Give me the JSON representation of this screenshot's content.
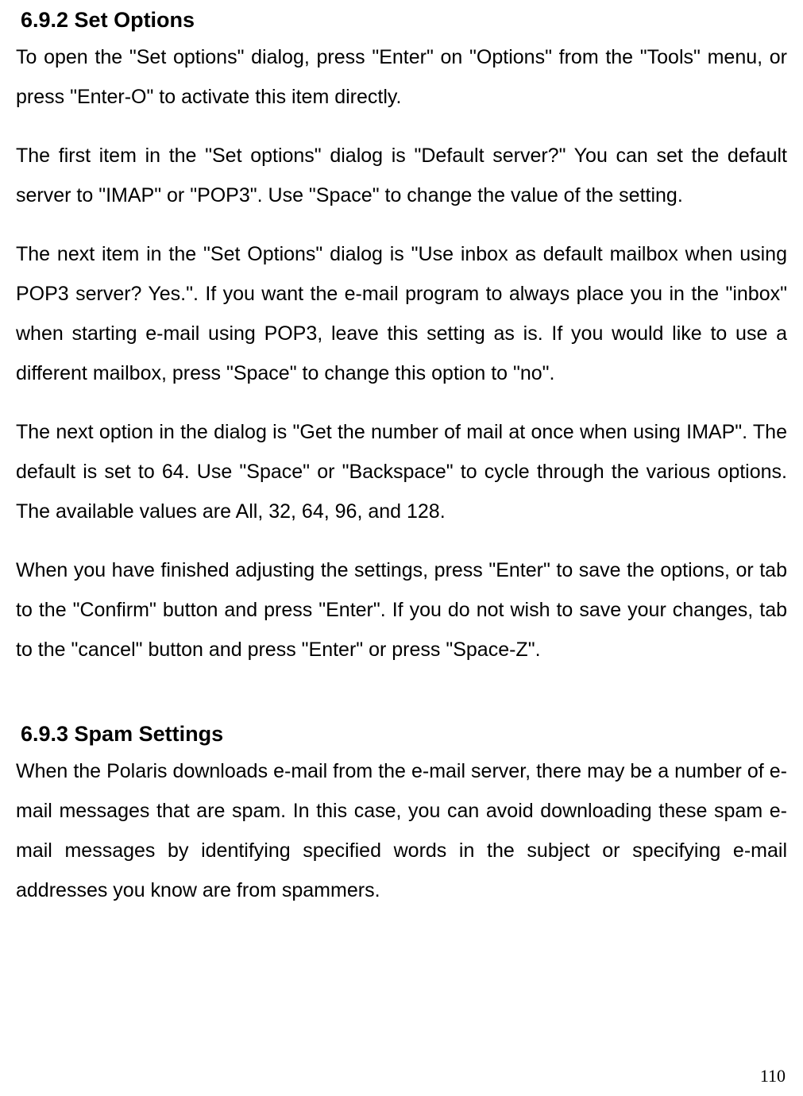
{
  "section1": {
    "heading": "6.9.2 Set Options",
    "p1": "To open the \"Set options\" dialog, press \"Enter\" on \"Options\" from the \"Tools\" menu, or press \"Enter-O\" to activate this item directly.",
    "p2": "The first item in the \"Set options\" dialog is \"Default server?\" You can set the default server to \"IMAP\" or \"POP3\". Use \"Space\" to change the value of the setting.",
    "p3": "The next item in the \"Set Options\" dialog is \"Use inbox as default mailbox when using POP3 server? Yes.\". If you want the e-mail program to always place you in the \"inbox\" when starting e-mail using POP3, leave this setting as is. If you would like to use a different mailbox, press \"Space\" to change this option to \"no\".",
    "p4": "The next option in the dialog is \"Get the number of mail at once when using IMAP\". The default is set to 64. Use \"Space\" or \"Backspace\" to cycle through the various options. The available values are All, 32, 64, 96, and 128.",
    "p5": "When you have finished adjusting the settings, press \"Enter\" to save the options, or tab to the \"Confirm\" button and press \"Enter\". If you do not wish to save your changes, tab to the \"cancel\" button and press \"Enter\" or press \"Space-Z\"."
  },
  "section2": {
    "heading": "6.9.3 Spam Settings",
    "p1": "When the Polaris downloads e-mail from the e-mail server, there may be a number of e-mail messages that are spam. In this case, you can avoid downloading these spam e-mail messages by identifying specified words in the subject or specifying e-mail addresses you know are from spammers."
  },
  "page_number": "110"
}
